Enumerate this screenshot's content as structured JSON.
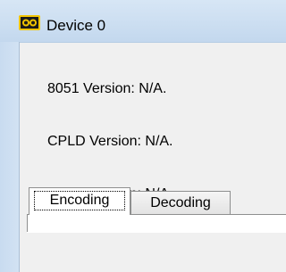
{
  "window": {
    "title": "Device 0",
    "icon": "device-app-icon"
  },
  "info": {
    "version_8051": "8051 Version: N/A.",
    "version_cpld": "CPLD Version: N/A.",
    "version_fpga": "FPGA Version: N/A."
  },
  "tabs": [
    {
      "label": "Encoding",
      "selected": true
    },
    {
      "label": "Decoding",
      "selected": false
    }
  ],
  "colors": {
    "titlebar": "#c3d8ee",
    "background": "#f0f0f0",
    "icon_yellow": "#f2c400"
  }
}
